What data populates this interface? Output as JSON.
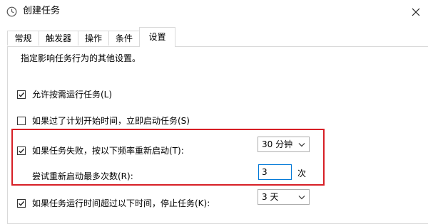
{
  "window": {
    "title": "创建任务",
    "icon": "task-scheduler-icon",
    "close_icon": "close-icon"
  },
  "tabs": [
    {
      "label": "常规",
      "active": false
    },
    {
      "label": "触发器",
      "active": false
    },
    {
      "label": "操作",
      "active": false
    },
    {
      "label": "条件",
      "active": false
    },
    {
      "label": "设置",
      "active": true
    }
  ],
  "settings": {
    "description": "指定影响任务行为的其他设置。",
    "allow_on_demand": {
      "label": "允许按需运行任务(L)",
      "checked": true
    },
    "run_missed": {
      "label": "如果过了计划开始时间，立即启动任务(S)",
      "checked": false
    },
    "restart_on_fail": {
      "label": "如果任务失败，按以下频率重新启动(T):",
      "checked": true,
      "interval": "30 分钟"
    },
    "restart_attempts": {
      "label": "尝试重新启动最多次数(R):",
      "value": "3",
      "unit": "次"
    },
    "stop_if_runs_longer": {
      "label": "如果任务运行时间超过以下时间，停止任务(K):",
      "checked": true,
      "duration": "3 天"
    }
  },
  "colors": {
    "highlight_border": "#d71f26",
    "focus_border": "#0078d7",
    "tab_border": "#d9d9d9"
  }
}
